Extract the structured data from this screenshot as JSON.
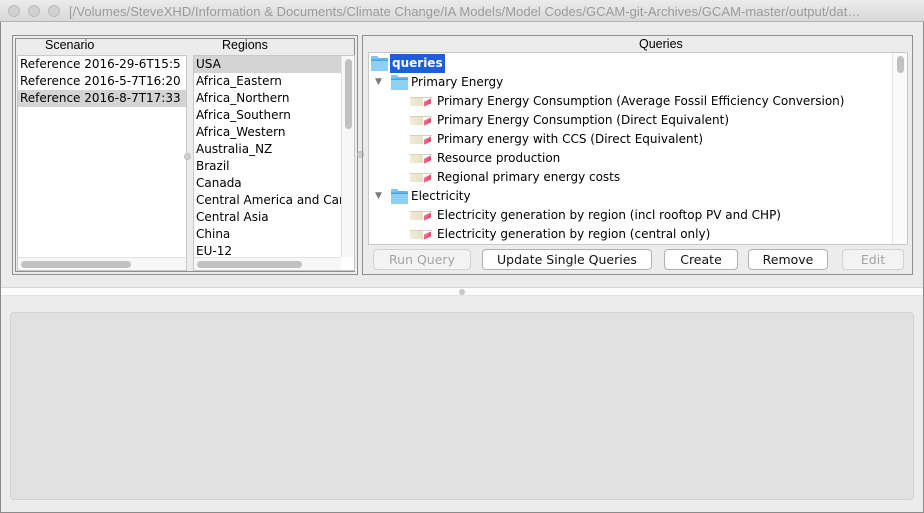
{
  "window": {
    "title": "[/Volumes/SteveXHD/Information & Documents/Climate Change/IA Models/Model Codes/GCAM-git-Archives/GCAM-master/output/dat…"
  },
  "scenarios": {
    "header": "Scenario",
    "items": [
      {
        "label": "Reference 2016-29-6T15:5",
        "selected": false
      },
      {
        "label": "Reference 2016-5-7T16:20",
        "selected": false
      },
      {
        "label": "Reference 2016-8-7T17:33",
        "selected": true
      }
    ]
  },
  "regions": {
    "header": "Regions",
    "items": [
      {
        "label": "USA",
        "selected": true
      },
      {
        "label": "Africa_Eastern",
        "selected": false
      },
      {
        "label": "Africa_Northern",
        "selected": false
      },
      {
        "label": "Africa_Southern",
        "selected": false
      },
      {
        "label": "Africa_Western",
        "selected": false
      },
      {
        "label": "Australia_NZ",
        "selected": false
      },
      {
        "label": "Brazil",
        "selected": false
      },
      {
        "label": "Canada",
        "selected": false
      },
      {
        "label": "Central America and Car",
        "selected": false
      },
      {
        "label": "Central Asia",
        "selected": false
      },
      {
        "label": "China",
        "selected": false
      },
      {
        "label": "EU-12",
        "selected": false
      }
    ]
  },
  "queries": {
    "header": "Queries",
    "root": "queries",
    "groups": [
      {
        "label": "Primary Energy",
        "expanded": true,
        "items": [
          "Primary Energy Consumption (Average Fossil Efficiency Conversion)",
          "Primary Energy Consumption (Direct Equivalent)",
          "Primary energy with CCS (Direct Equivalent)",
          "Resource production",
          "Regional primary energy costs"
        ]
      },
      {
        "label": "Electricity",
        "expanded": true,
        "items": [
          "Electricity generation by region (incl rooftop PV and CHP)",
          "Electricity generation by region (central only)"
        ]
      }
    ]
  },
  "buttons": {
    "run_query": {
      "label": "Run Query",
      "enabled": false
    },
    "update_single_queries": {
      "label": "Update Single Queries",
      "enabled": true
    },
    "create": {
      "label": "Create",
      "enabled": true
    },
    "remove": {
      "label": "Remove",
      "enabled": true
    },
    "edit": {
      "label": "Edit",
      "enabled": false
    }
  }
}
